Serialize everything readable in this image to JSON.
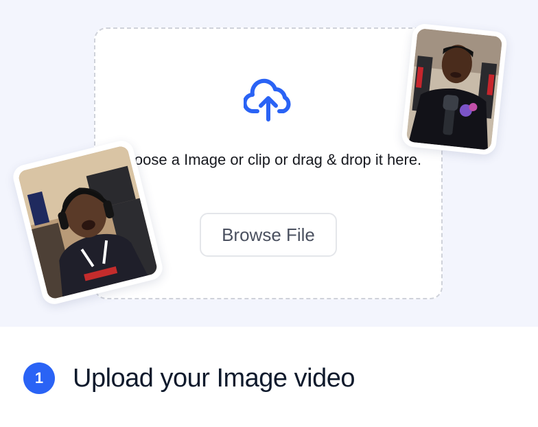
{
  "upload": {
    "prompt": "Choose a Image or clip or drag & drop it here.",
    "browse_label": "Browse File"
  },
  "icons": {
    "upload": "cloud-upload-icon"
  },
  "colors": {
    "accent": "#2a63f5",
    "hero_background": "#f3f5fd",
    "title": "#0f1a2c"
  },
  "step": {
    "number": "1",
    "title": "Upload your Image video"
  }
}
